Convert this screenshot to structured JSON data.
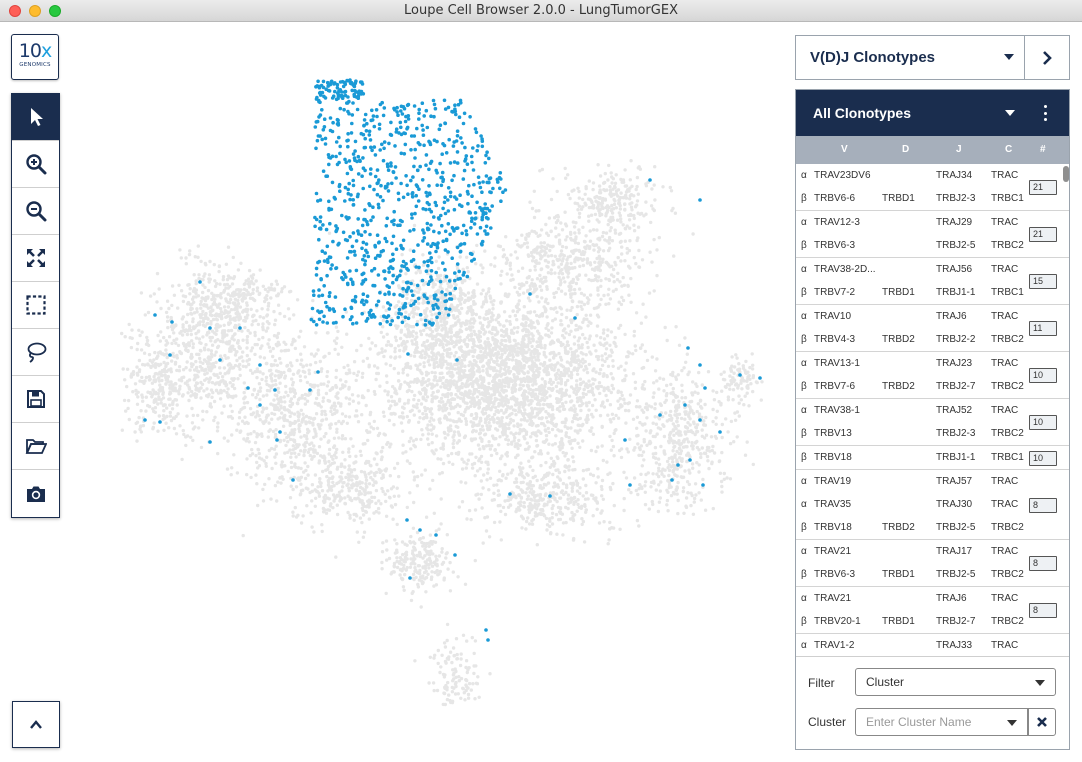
{
  "window": {
    "title": "Loupe Cell Browser 2.0.0 - LungTumorGEX"
  },
  "logo": {
    "main": "10",
    "accent": "x",
    "sub": "GENOMICS"
  },
  "toolbar": {
    "tools": [
      {
        "name": "select-pointer-tool",
        "icon": "pointer-icon",
        "active": true
      },
      {
        "name": "zoom-in-tool",
        "icon": "zoom-in-icon"
      },
      {
        "name": "zoom-out-tool",
        "icon": "zoom-out-icon"
      },
      {
        "name": "fit-view-tool",
        "icon": "fit-view-icon"
      },
      {
        "name": "rectangle-select-tool",
        "icon": "rectangle-select-icon"
      },
      {
        "name": "lasso-tool",
        "icon": "lasso-icon"
      },
      {
        "name": "save-tool",
        "icon": "save-icon"
      },
      {
        "name": "open-tool",
        "icon": "open-folder-icon"
      },
      {
        "name": "screenshot-tool",
        "icon": "camera-icon"
      }
    ]
  },
  "plot": {
    "background_color": "#e6e6e6",
    "highlight_color": "#1a9ad6"
  },
  "vdj_selector": {
    "label": "V(D)J Clonotypes"
  },
  "clonotype_panel": {
    "title": "All Clonotypes",
    "columns": {
      "v": "V",
      "d": "D",
      "j": "J",
      "c": "C",
      "count": "#"
    },
    "rows": [
      {
        "count": "21",
        "chains": [
          {
            "chain": "α",
            "v": "TRAV23DV6",
            "d": "",
            "j": "TRAJ34",
            "c": "TRAC"
          },
          {
            "chain": "β",
            "v": "TRBV6-6",
            "d": "TRBD1",
            "j": "TRBJ2-3",
            "c": "TRBC1"
          }
        ]
      },
      {
        "count": "21",
        "chains": [
          {
            "chain": "α",
            "v": "TRAV12-3",
            "d": "",
            "j": "TRAJ29",
            "c": "TRAC"
          },
          {
            "chain": "β",
            "v": "TRBV6-3",
            "d": "",
            "j": "TRBJ2-5",
            "c": "TRBC2"
          }
        ]
      },
      {
        "count": "15",
        "chains": [
          {
            "chain": "α",
            "v": "TRAV38-2D...",
            "d": "",
            "j": "TRAJ56",
            "c": "TRAC"
          },
          {
            "chain": "β",
            "v": "TRBV7-2",
            "d": "TRBD1",
            "j": "TRBJ1-1",
            "c": "TRBC1"
          }
        ]
      },
      {
        "count": "11",
        "chains": [
          {
            "chain": "α",
            "v": "TRAV10",
            "d": "",
            "j": "TRAJ6",
            "c": "TRAC"
          },
          {
            "chain": "β",
            "v": "TRBV4-3",
            "d": "TRBD2",
            "j": "TRBJ2-2",
            "c": "TRBC2"
          }
        ]
      },
      {
        "count": "10",
        "chains": [
          {
            "chain": "α",
            "v": "TRAV13-1",
            "d": "",
            "j": "TRAJ23",
            "c": "TRAC"
          },
          {
            "chain": "β",
            "v": "TRBV7-6",
            "d": "TRBD2",
            "j": "TRBJ2-7",
            "c": "TRBC2"
          }
        ]
      },
      {
        "count": "10",
        "chains": [
          {
            "chain": "α",
            "v": "TRAV38-1",
            "d": "",
            "j": "TRAJ52",
            "c": "TRAC"
          },
          {
            "chain": "β",
            "v": "TRBV13",
            "d": "",
            "j": "TRBJ2-3",
            "c": "TRBC2"
          }
        ]
      },
      {
        "count": "10",
        "chains": [
          {
            "chain": "β",
            "v": "TRBV18",
            "d": "",
            "j": "TRBJ1-1",
            "c": "TRBC1"
          }
        ]
      },
      {
        "count": "8",
        "chains": [
          {
            "chain": "α",
            "v": "TRAV19",
            "d": "",
            "j": "TRAJ57",
            "c": "TRAC"
          },
          {
            "chain": "α",
            "v": "TRAV35",
            "d": "",
            "j": "TRAJ30",
            "c": "TRAC"
          },
          {
            "chain": "β",
            "v": "TRBV18",
            "d": "TRBD2",
            "j": "TRBJ2-5",
            "c": "TRBC2"
          }
        ]
      },
      {
        "count": "8",
        "chains": [
          {
            "chain": "α",
            "v": "TRAV21",
            "d": "",
            "j": "TRAJ17",
            "c": "TRAC"
          },
          {
            "chain": "β",
            "v": "TRBV6-3",
            "d": "TRBD1",
            "j": "TRBJ2-5",
            "c": "TRBC2"
          }
        ]
      },
      {
        "count": "8",
        "chains": [
          {
            "chain": "α",
            "v": "TRAV21",
            "d": "",
            "j": "TRAJ6",
            "c": "TRAC"
          },
          {
            "chain": "β",
            "v": "TRBV20-1",
            "d": "TRBD1",
            "j": "TRBJ2-7",
            "c": "TRBC2"
          }
        ]
      },
      {
        "count": "",
        "chains": [
          {
            "chain": "α",
            "v": "TRAV1-2",
            "d": "",
            "j": "TRAJ33",
            "c": "TRAC"
          }
        ]
      }
    ]
  },
  "filters": {
    "filter_label": "Filter",
    "filter_value": "Cluster",
    "cluster_label": "Cluster",
    "cluster_placeholder": "Enter Cluster Name"
  }
}
